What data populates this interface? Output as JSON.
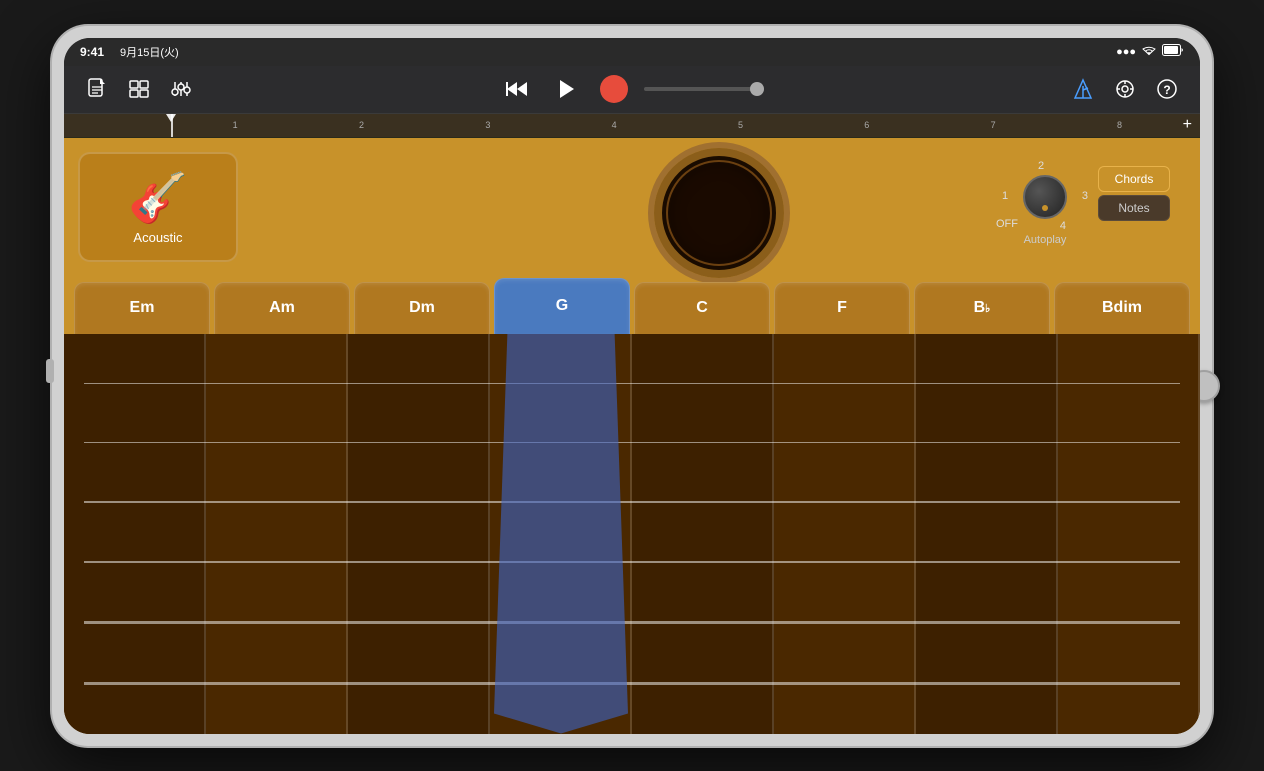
{
  "status_bar": {
    "time": "9:41",
    "date": "9月15日(火)",
    "battery": "100%",
    "wifi": "WiFi",
    "signal": "●●●"
  },
  "toolbar": {
    "document_icon": "📄",
    "tracks_icon": "⊞",
    "mixer_icon": "⚙",
    "rewind_icon": "⏮",
    "play_icon": "▶",
    "record_label": "●",
    "metronome_icon": "🎵",
    "settings_icon": "⏱",
    "help_icon": "?"
  },
  "timeline": {
    "marks": [
      "1",
      "2",
      "3",
      "4",
      "5",
      "6",
      "7",
      "8"
    ],
    "add_label": "+"
  },
  "instrument": {
    "name": "Acoustic",
    "icon": "🎸"
  },
  "autoplay": {
    "label": "Autoplay",
    "positions": [
      "1",
      "2",
      "3",
      "4",
      "OFF"
    ]
  },
  "mode_toggle": {
    "chords_label": "Chords",
    "notes_label": "Notes",
    "active": "Chords"
  },
  "chords": {
    "items": [
      {
        "label": "Em",
        "active": false
      },
      {
        "label": "Am",
        "active": false
      },
      {
        "label": "Dm",
        "active": false
      },
      {
        "label": "G",
        "active": true
      },
      {
        "label": "C",
        "active": false
      },
      {
        "label": "F",
        "active": false
      },
      {
        "label": "B♭",
        "active": false
      },
      {
        "label": "Bdim",
        "active": false
      }
    ]
  },
  "fretboard": {
    "strings": 6,
    "frets": 8
  }
}
